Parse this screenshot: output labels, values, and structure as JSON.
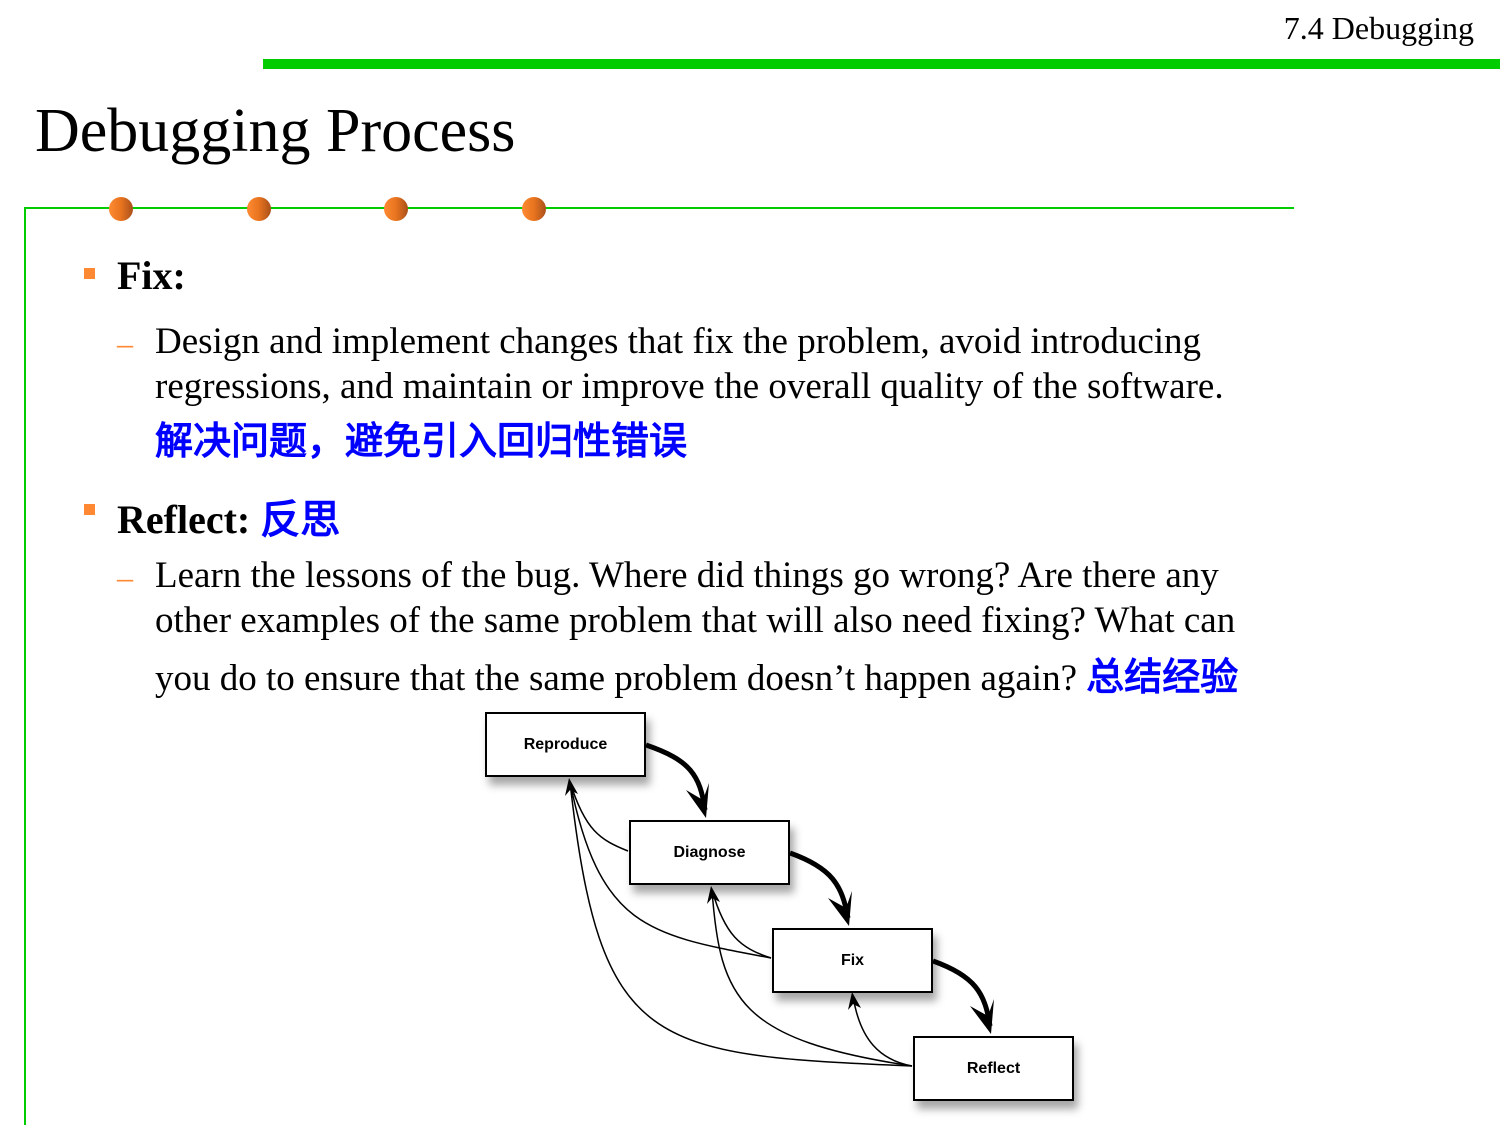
{
  "header": {
    "section": "7.4 Debugging"
  },
  "title": "Debugging Process",
  "bullets": [
    {
      "heading": "Fix:",
      "sub_lines": [
        "Design and implement changes that fix the problem, avoid introducing",
        "regressions, and maintain or improve the overall quality of the software."
      ],
      "note_cn": "解决问题，避免引入回归性错误"
    },
    {
      "heading": "Reflect:",
      "heading_cn": "反思",
      "sub_lines": [
        "Learn the lessons of the bug. Where did things go wrong? Are there any",
        "other examples of the same problem that will also need fixing? What can",
        "you do to ensure that the same problem doesn’t happen again?"
      ],
      "note_cn": "总结经验"
    }
  ],
  "diagram": {
    "nodes": [
      "Reproduce",
      "Diagnose",
      "Fix",
      "Reflect"
    ]
  },
  "colors": {
    "accent_green": "#00cc00",
    "bullet_orange": "#ff8833",
    "chinese_blue": "#0000ff"
  }
}
